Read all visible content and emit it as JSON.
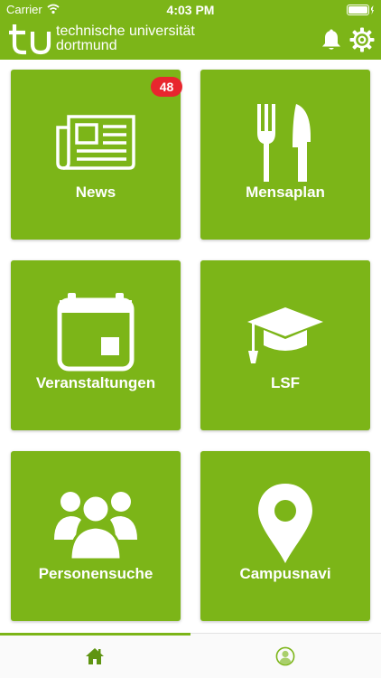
{
  "status_bar": {
    "carrier": "Carrier",
    "time": "4:03 PM",
    "wifi_icon": "wifi-icon",
    "battery_icon": "battery-charging-icon"
  },
  "app_bar": {
    "logo_text": "tu",
    "brand_line1": "technische universität",
    "brand_line2": "dortmund",
    "notification_icon": "bell-icon",
    "settings_icon": "gear-icon"
  },
  "colors": {
    "brand_green": "#7cb518",
    "badge_red": "#e8262e",
    "tab_bar_bg": "#fafafa"
  },
  "tiles": [
    {
      "label": "News",
      "icon": "newspaper-icon",
      "badge": "48"
    },
    {
      "label": "Mensaplan",
      "icon": "fork-knife-icon"
    },
    {
      "label": "Veranstaltungen",
      "icon": "calendar-icon"
    },
    {
      "label": "LSF",
      "icon": "graduation-cap-icon"
    },
    {
      "label": "Personensuche",
      "icon": "people-icon"
    },
    {
      "label": "Campusnavi",
      "icon": "map-pin-icon"
    }
  ],
  "tab_bar": {
    "active_tab": "home",
    "tabs": [
      {
        "name": "home",
        "icon": "home-icon"
      },
      {
        "name": "profile",
        "icon": "profile-icon"
      }
    ]
  }
}
